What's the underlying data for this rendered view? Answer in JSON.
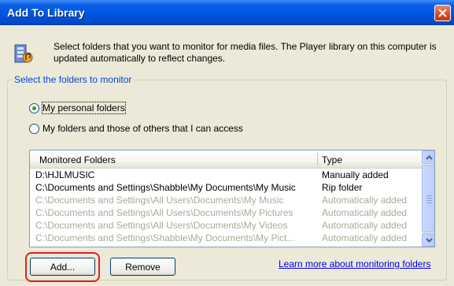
{
  "window": {
    "title": "Add To Library"
  },
  "intro": {
    "text": "Select folders that you want to monitor for media files. The Player library on this computer is updated automatically to reflect changes."
  },
  "group": {
    "legend": "Select the folders to monitor",
    "options": [
      {
        "label": "My personal folders",
        "selected": true
      },
      {
        "label": "My folders and those of others that I can access",
        "selected": false
      }
    ]
  },
  "list": {
    "columns": [
      "Monitored Folders",
      "Type"
    ],
    "rows": [
      {
        "folder": "D:\\HJLMUSIC",
        "type": "Manually added"
      },
      {
        "folder": "C:\\Documents and Settings\\Shabble\\My Documents\\My Music",
        "type": "Rip folder"
      },
      {
        "folder": "C:\\Documents and Settings\\All Users\\Documents\\My Music",
        "type": "Automatically added"
      },
      {
        "folder": "C:\\Documents and Settings\\All Users\\Documents\\My Pictures",
        "type": "Automatically added"
      },
      {
        "folder": "C:\\Documents and Settings\\All Users\\Documents\\My Videos",
        "type": "Automatically added"
      },
      {
        "folder": "C:\\Documents and Settings\\Shabble\\My Documents\\My Pict...",
        "type": "Automatically added"
      }
    ]
  },
  "buttons": {
    "add": "Add...",
    "remove": "Remove"
  },
  "link": {
    "text": "Learn more about monitoring folders"
  },
  "colors": {
    "titlebar": "#0054e3",
    "legend": "#0046d5",
    "highlight": "#e02020",
    "link": "#0000ee"
  },
  "icons": {
    "intro": "media-library-icon",
    "close": "close-icon"
  }
}
